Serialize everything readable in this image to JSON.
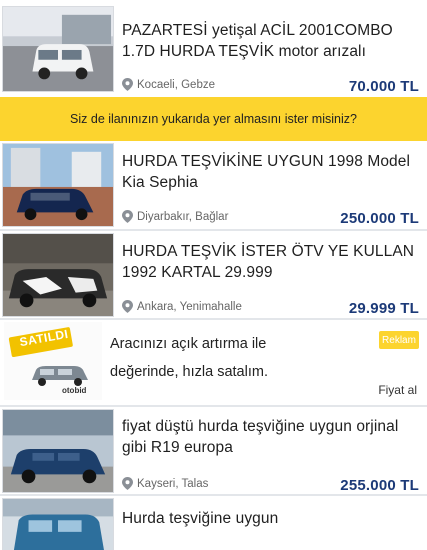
{
  "listings": [
    {
      "title": "PAZARTESİ yetişal ACİL 2001COMBO 1.7D HURDA TEŞVİK motor arızalı",
      "location": "Kocaeli, Gebze",
      "price": "70.000 TL"
    },
    {
      "title": "HURDA TEŞVİKİNE UYGUN 1998 Model Kia Sephia",
      "location": "Diyarbakır, Bağlar",
      "price": "250.000 TL"
    },
    {
      "title": "HURDA TEŞVİK İSTER ÖTV YE KULLAN 1992 KARTAL 29.999",
      "location": "Ankara, Yenimahalle",
      "price": "29.999 TL"
    },
    {
      "title": "fiyat düştü hurda teşviğine uygun orjinal gibi R19 europa",
      "location": "Kayseri, Talas",
      "price": "255.000 TL"
    },
    {
      "title": "Hurda teşviğine uygun",
      "location": "",
      "price": ""
    }
  ],
  "promo_banner": {
    "text": "Siz de ilanınızın yukarıda yer almasını ister misiniz?"
  },
  "ad": {
    "line1": "Aracınızı açık artırma ile",
    "line2": "değerinde, hızla satalım.",
    "badge": "Reklam",
    "link": "Fiyat al",
    "image_stamp": "SATILDI",
    "image_brand": "otobid"
  },
  "colors": {
    "accent_yellow": "#fcd42e",
    "price_blue": "#1c3a78"
  },
  "icons": {
    "location": "map-pin-icon"
  }
}
